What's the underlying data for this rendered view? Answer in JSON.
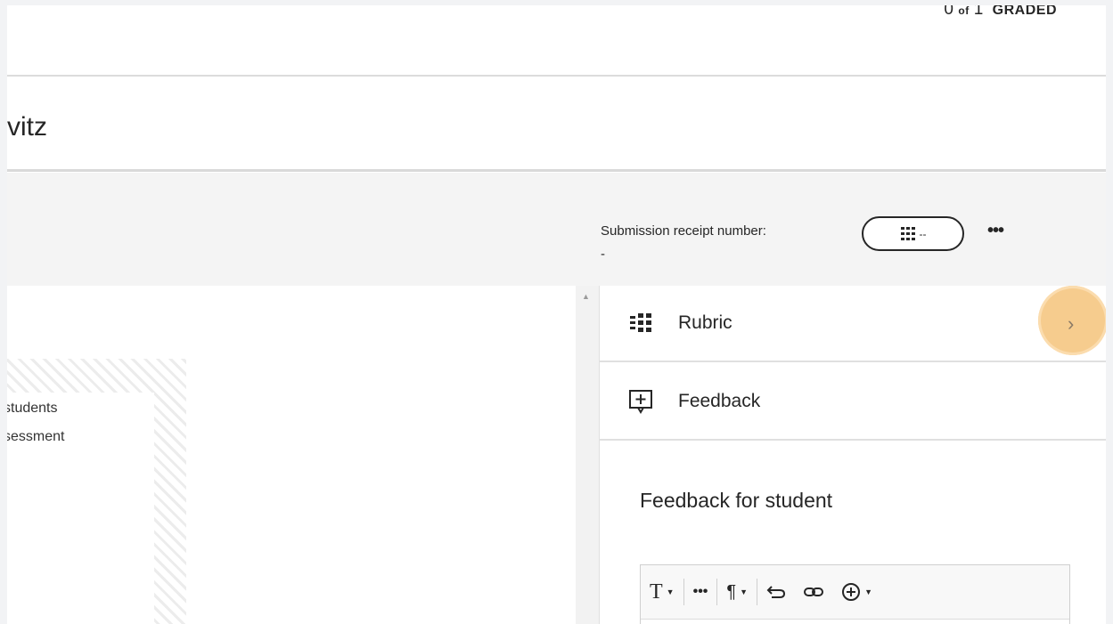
{
  "header": {
    "graded_count": "0",
    "graded_of": "of",
    "graded_total": "1",
    "graded_label": "GRADED"
  },
  "student": {
    "name_fragment": "vitz"
  },
  "submission": {
    "receipt_label": "Submission receipt number:",
    "receipt_value": "-",
    "pill_text": "--",
    "more_icon": "more-horizontal-icon"
  },
  "document": {
    "lines": [
      "students",
      "sessment"
    ]
  },
  "panel": {
    "rubric_label": "Rubric",
    "feedback_label": "Feedback",
    "feedback_title": "Feedback for student",
    "highlight_color": "#f6c782"
  },
  "editor": {
    "tools": [
      {
        "name": "text-format-icon",
        "glyph": "T"
      },
      {
        "name": "more-options-icon",
        "glyph": "•••"
      },
      {
        "name": "paragraph-icon",
        "glyph": "¶"
      },
      {
        "name": "undo-icon",
        "glyph": "⮌"
      },
      {
        "name": "link-icon",
        "glyph": "⊝"
      },
      {
        "name": "insert-add-icon",
        "glyph": "⊕"
      }
    ]
  }
}
